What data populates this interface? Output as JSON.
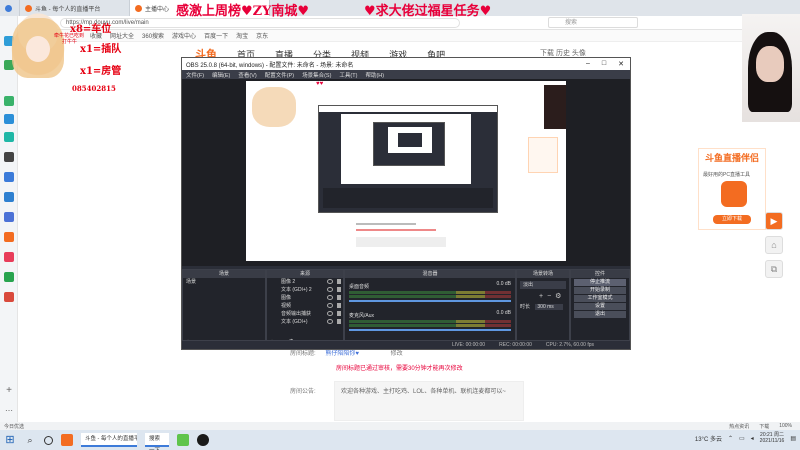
{
  "browser": {
    "tabs": [
      {
        "label": "斗鱼 - 每个人的直播平台"
      },
      {
        "label": "主播中心"
      }
    ],
    "url": "https://mp.douyu.com/live/main",
    "search_placeholder": "搜索",
    "bookmarks": [
      "收藏",
      "网址大全",
      "360搜索",
      "游戏中心",
      "百度一下",
      "淘宝",
      "京东"
    ]
  },
  "douyu": {
    "logo": "斗鱼",
    "nav": [
      "首页",
      "直播",
      "分类",
      "视频",
      "游戏",
      "鱼吧"
    ],
    "right_nav": "下载   历史   头像"
  },
  "overlay": {
    "banner_left": "感激上周榜♥ZY南城♥",
    "banner_right": "♥求大佬过福星任务♥",
    "sticker": {
      "line1": "x8=车位",
      "line2": "x1=插队",
      "line3": "x1=房管",
      "code": "085402815",
      "sub1": "牵牛花已吃到",
      "sub2": "打牛牛"
    }
  },
  "promo": {
    "title": "斗鱼直播伴侣",
    "subtitle": "最好用的PC直播工具",
    "button": "立即下载"
  },
  "obs": {
    "title": "OBS 25.0.8 (64-bit, windows) - 配置文件: 未命名 - 场景: 未命名",
    "menu": [
      "文件(F)",
      "编辑(E)",
      "查看(V)",
      "配置文件(P)",
      "场景集合(S)",
      "工具(T)",
      "帮助(H)"
    ],
    "docks": {
      "scenes": {
        "title": "场景",
        "items": [
          "场景"
        ]
      },
      "sources": {
        "title": "来源",
        "items": [
          "图像 2",
          "文本 (GDI+) 2",
          "图像",
          "视频",
          "音频输出捕获",
          "文本 (GDI+)"
        ]
      },
      "mixer": {
        "title": "混音器",
        "channels": [
          {
            "name": "桌面音频",
            "level": "0.0 dB"
          },
          {
            "name": "麦克风/Aux",
            "level": "0.0 dB"
          }
        ]
      },
      "transitions": {
        "title": "场景转场",
        "type": "淡出",
        "duration_label": "时长",
        "duration": "300 ms"
      },
      "controls": {
        "title": "控件",
        "buttons": [
          "停止推流",
          "开始录制",
          "工作室模式",
          "设置",
          "退出"
        ]
      }
    },
    "status": {
      "live": "LIVE: 00:00:00",
      "rec": "REC: 00:00:00",
      "cpu": "CPU: 2.7%, 60.00 fps"
    }
  },
  "room": {
    "title_label": "房间标题:",
    "title_value": "熊仔陪陪你♥",
    "edit_label": "修改",
    "title_warning": "房间标题已通过审核，需要30分钟才能再次修改",
    "notice_label": "房间公告:",
    "notice_text": "欢迎各种游戏、主打吃鸡、LOL、各种单机、联机连麦都可以~"
  },
  "statusbar": {
    "left": "今日优选",
    "items": [
      "热点资讯",
      "下载",
      "100%"
    ]
  },
  "taskbar": {
    "search_label": "搜索一下",
    "app_label": "斗鱼 - 每个人的直播平台",
    "weather": "13°C 多云",
    "time": "20:21 周二",
    "date": "2021/11/16"
  }
}
